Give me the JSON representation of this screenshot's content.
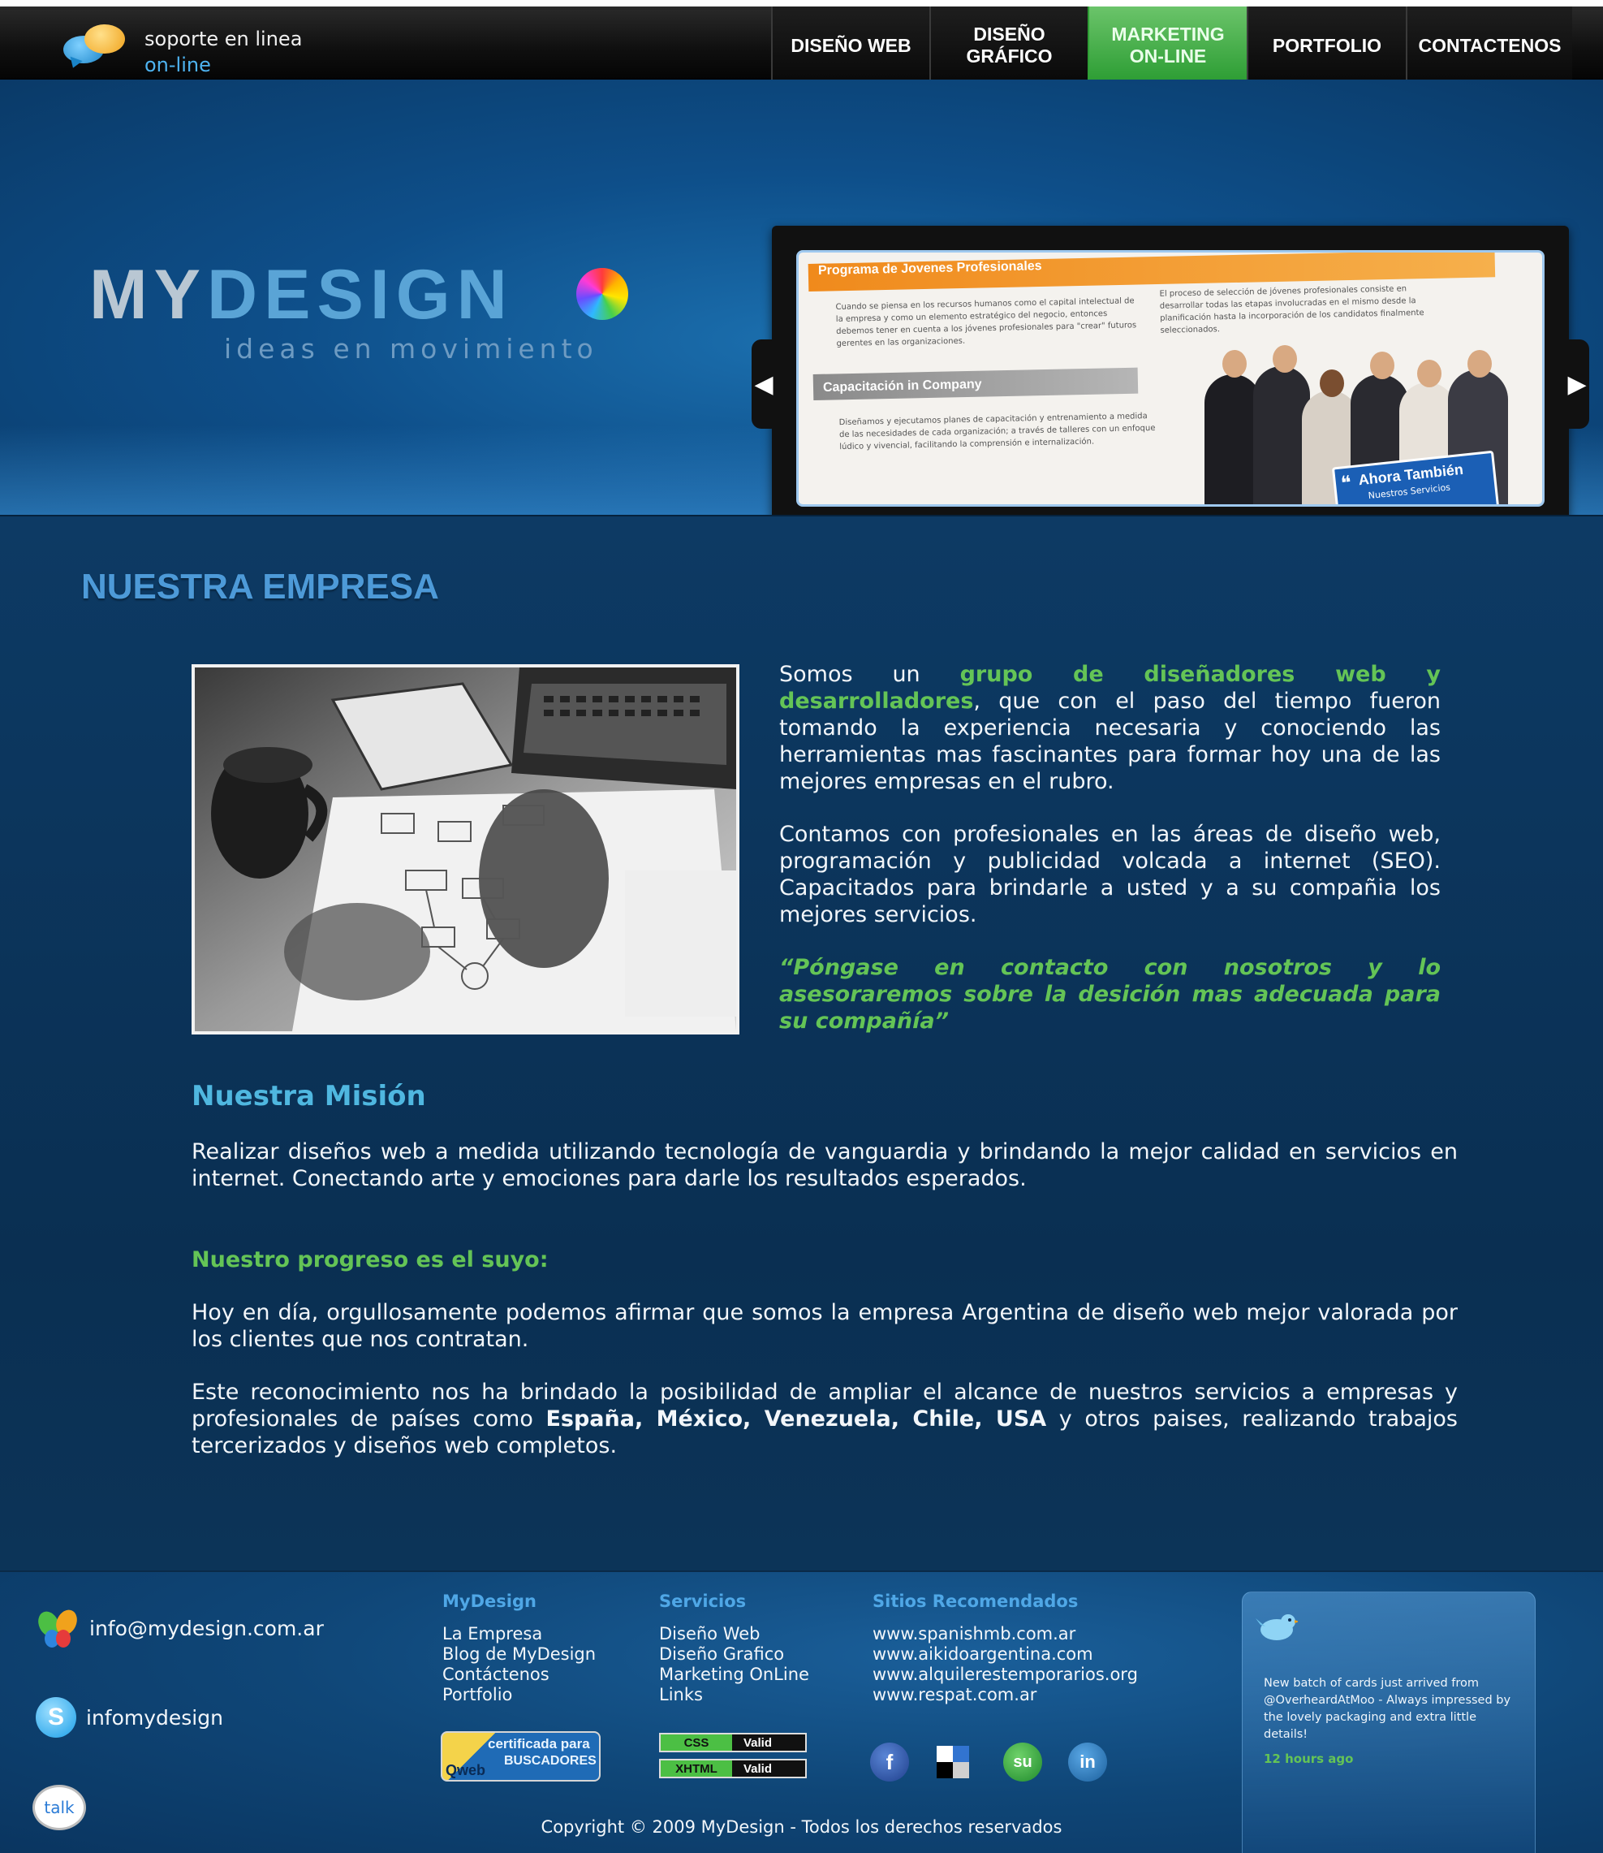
{
  "header": {
    "support_line1": "soporte en linea",
    "support_line2": "on-line",
    "nav": [
      {
        "label": "DISEÑO WEB"
      },
      {
        "label_line1": "DISEÑO",
        "label_line2": "GRÁFICO"
      },
      {
        "label_line1": "MARKETING",
        "label_line2": "ON-LINE",
        "active": true
      },
      {
        "label": "PORTFOLIO"
      },
      {
        "label": "CONTACTENOS"
      }
    ]
  },
  "hero": {
    "logo_my": "MY",
    "logo_design": "DESIGN",
    "logo_tagline": "ideas en movimiento",
    "slide": {
      "title1": "Programa de Jovenes Profesionales",
      "text1": "Cuando se piensa en los recursos humanos como el capital intelectual de la empresa y como un elemento estratégico del negocio, entonces debemos tener en cuenta a los jóvenes profesionales para \"crear\" futuros gerentes en las organizaciones.",
      "text2": "El proceso de selección de jóvenes profesionales consiste en desarrollar todas las etapas involucradas en el mismo desde la planificación hasta la incorporación de los candidatos finalmente seleccionados.",
      "title2": "Capacitación in Company",
      "text3": "Diseñamos y ejecutamos planes de capacitación y entrenamiento a medida de las necesidades de cada organización; a través de talleres con un enfoque lúdico y vivencial, facilitando la comprensión e internalización.",
      "badge_main": "Ahora También",
      "badge_sub": "Nuestros Servicios"
    },
    "prev_glyph": "◀",
    "next_glyph": "▶"
  },
  "content": {
    "section_title": "NUESTRA EMPRESA",
    "p1_pre": "Somos un ",
    "p1_green": "grupo de diseñadores web y desarrolladores",
    "p1_post": ", que con el paso del tiempo fueron tomando la experiencia necesaria y conociendo las herramientas mas fascinantes para formar hoy una de las mejores empresas en el rubro.",
    "p2": "Contamos con profesionales en las áreas de diseño web, programación y publicidad volcada a internet (SEO). Capacitados para brindarle a usted y a su compañia los mejores servicios.",
    "quote": "“Póngase en contacto con nosotros y lo asesoraremos sobre la desición mas adecuada para su compañía”",
    "mision_title": "Nuestra Misión",
    "mision_text": "Realizar diseños web a medida utilizando tecnología de vanguardia y brindando la mejor calidad en servicios en internet. Conectando arte y emociones para darle los resultados esperados.",
    "progreso_title": "Nuestro progreso es el suyo:",
    "progreso_text1": "Hoy en día, orgullosamente podemos afirmar que somos la empresa Argentina de diseño web mejor valorada por los clientes que nos contratan.",
    "progreso_text2_pre": "Este reconocimiento nos ha brindado la posibilidad de ampliar el alcance de nuestros servicios a empresas y profesionales de países como ",
    "progreso_text2_bold": "España, México, Venezuela, Chile, USA",
    "progreso_text2_post": " y otros paises, realizando trabajos tercerizados y diseños web completos."
  },
  "footer": {
    "email": "info@mydesign.com.ar",
    "skype": "infomydesign",
    "skype_glyph": "S",
    "talk_label": "talk",
    "col1": {
      "title": "MyDesign",
      "links": [
        "La Empresa",
        "Blog de MyDesign",
        "Contáctenos",
        "Portfolio"
      ]
    },
    "col2": {
      "title": "Servicios",
      "links": [
        "Diseño Web",
        "Diseño Grafico",
        "Marketing OnLine",
        "Links"
      ]
    },
    "col3": {
      "title": "Sitios Recomendados",
      "links": [
        "www.spanishmb.com.ar",
        "www.aikidoargentina.com",
        "www.alquilerestemporarios.org",
        "www.respat.com.ar"
      ]
    },
    "qweb_line1": "certificada para",
    "qweb_line2": "BUSCADORES",
    "qweb_brand": "Qweb",
    "css_badge": {
      "key": "CSS",
      "value": "Valid"
    },
    "xhtml_badge": {
      "key": "XHTML",
      "value": "Valid"
    },
    "social": {
      "facebook": "f",
      "stumbleupon": "su",
      "linkedin": "in"
    },
    "tweet_text": "New batch of cards just arrived from @OverheardAtMoo - Always impressed by the lovely packaging and extra little details!",
    "tweet_time": "12 hours ago",
    "copyright": "Copyright © 2009 MyDesign - Todos los derechos reservados"
  }
}
